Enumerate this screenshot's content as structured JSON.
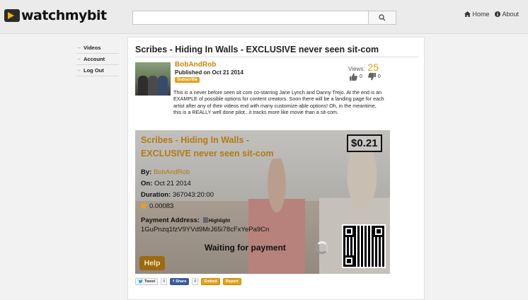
{
  "header": {
    "logo_text": "watchmybit",
    "search_placeholder": "",
    "nav": [
      {
        "label": "Home",
        "icon": "home-icon"
      },
      {
        "label": "About",
        "icon": "info-icon"
      }
    ]
  },
  "sidebar": {
    "items": [
      {
        "label": "Videos"
      },
      {
        "label": "Account"
      },
      {
        "label": "Log Out"
      }
    ]
  },
  "video": {
    "title": "Scribes - Hiding In Walls - EXCLUSIVE never seen sit-com",
    "author": "BobAndRob",
    "published": "Published on Oct 21 2014",
    "subscribe_label": "Subscribe",
    "views_label": "Views:",
    "views": "25",
    "likes": "0",
    "dislikes": "0",
    "description": "This is a never before seen sit com co-starring Jane Lynch and Danny Trejo. At the end is an EXAMPLE of possible options for content creators. Soon there will be a landing page for each artist after any of their videos end with many customize-able options! Oh, in the meantime, this is a REALLY well done pilot...it tracks more like movie than a sit-com."
  },
  "paywall": {
    "title_line1": "Scribes - Hiding In Walls -",
    "title_line2": "EXCLUSIVE never seen sit-com",
    "price": "$0.21",
    "by_label": "By:",
    "by_value": "BobAndRob",
    "on_label": "On:",
    "on_value": "Oct 21 2014",
    "duration_label": "Duration:",
    "duration_value": "367043:20:00",
    "btc_amount": "0.00083",
    "address_label": "Payment Address:",
    "highlight_label": "Highlight",
    "address": "1GuPnzq1fzV9YVd9MrJ65i78cFxYePa9Cn",
    "waiting": "Waiting for payment",
    "help_label": "Help"
  },
  "share": {
    "tweet_label": "Tweet",
    "tweet_count": "0",
    "fb_label": "Share",
    "fb_count": "0",
    "embed_label": "Embed",
    "report_label": "Report"
  },
  "colors": {
    "accent": "#e1a11a",
    "title_gold": "#b07b12",
    "help_brown": "#9c6a12"
  }
}
